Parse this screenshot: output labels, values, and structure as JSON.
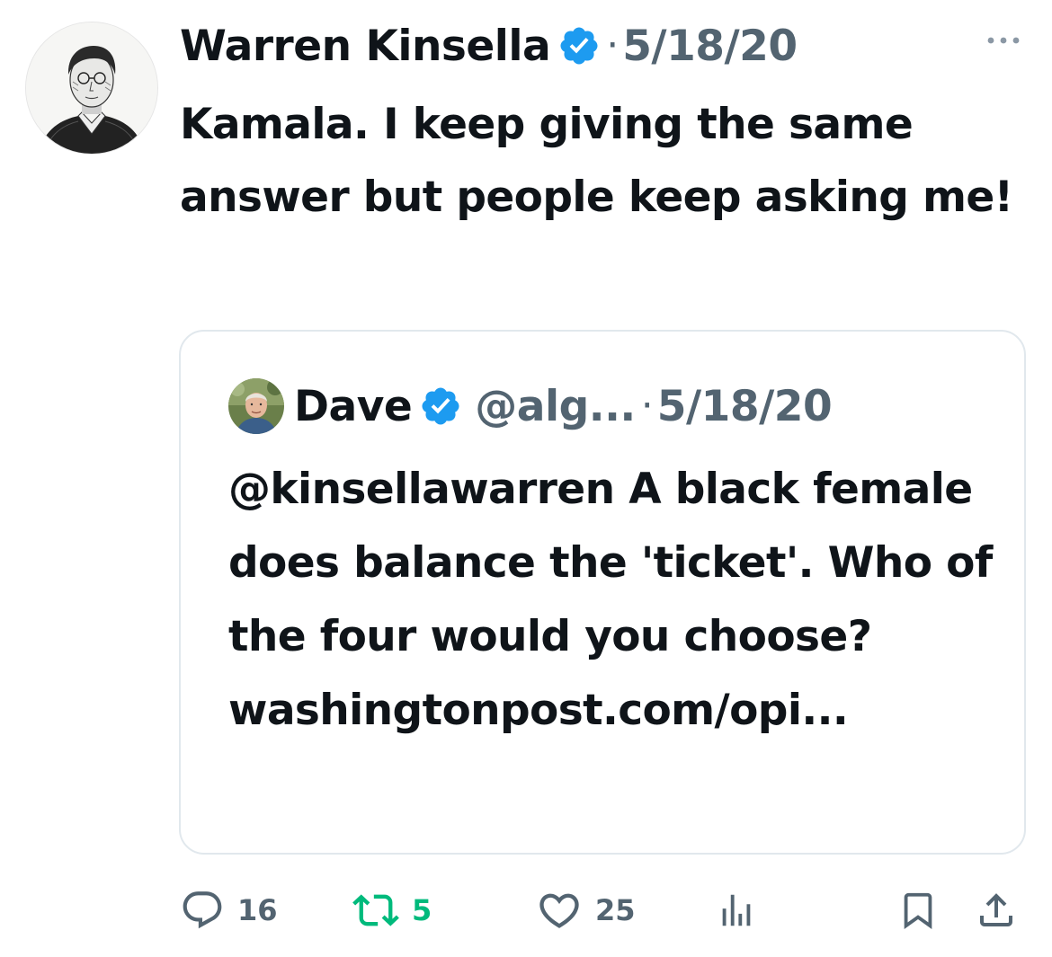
{
  "tweet": {
    "author_name": "Warren Kinsella",
    "verified_icon": "verified-badge-icon",
    "separator": "·",
    "date": "5/18/20",
    "more_icon": "more-dots-icon",
    "text": "Kamala. I keep giving the same answer but people keep asking me!"
  },
  "quoted_tweet": {
    "author_name": "Dave",
    "verified_icon": "verified-badge-icon",
    "handle": "@alg...",
    "separator": "·",
    "date": "5/18/20",
    "text": "@kinsellawarren A black female does balance the 'ticket'. Who of the four would you choose? washingtonpost.com/opi..."
  },
  "actions": {
    "reply": {
      "icon": "reply-icon",
      "count": "16"
    },
    "retweet": {
      "icon": "retweet-icon",
      "count": "5"
    },
    "like": {
      "icon": "heart-icon",
      "count": "25"
    },
    "views": {
      "icon": "views-chart-icon"
    },
    "bookmark": {
      "icon": "bookmark-icon"
    },
    "share": {
      "icon": "share-icon"
    }
  },
  "colors": {
    "text_primary": "#0f1419",
    "text_secondary": "#536471",
    "verified_blue": "#1d9bf0",
    "retweet_green": "#00ba7c",
    "border": "#e1e8ed"
  }
}
